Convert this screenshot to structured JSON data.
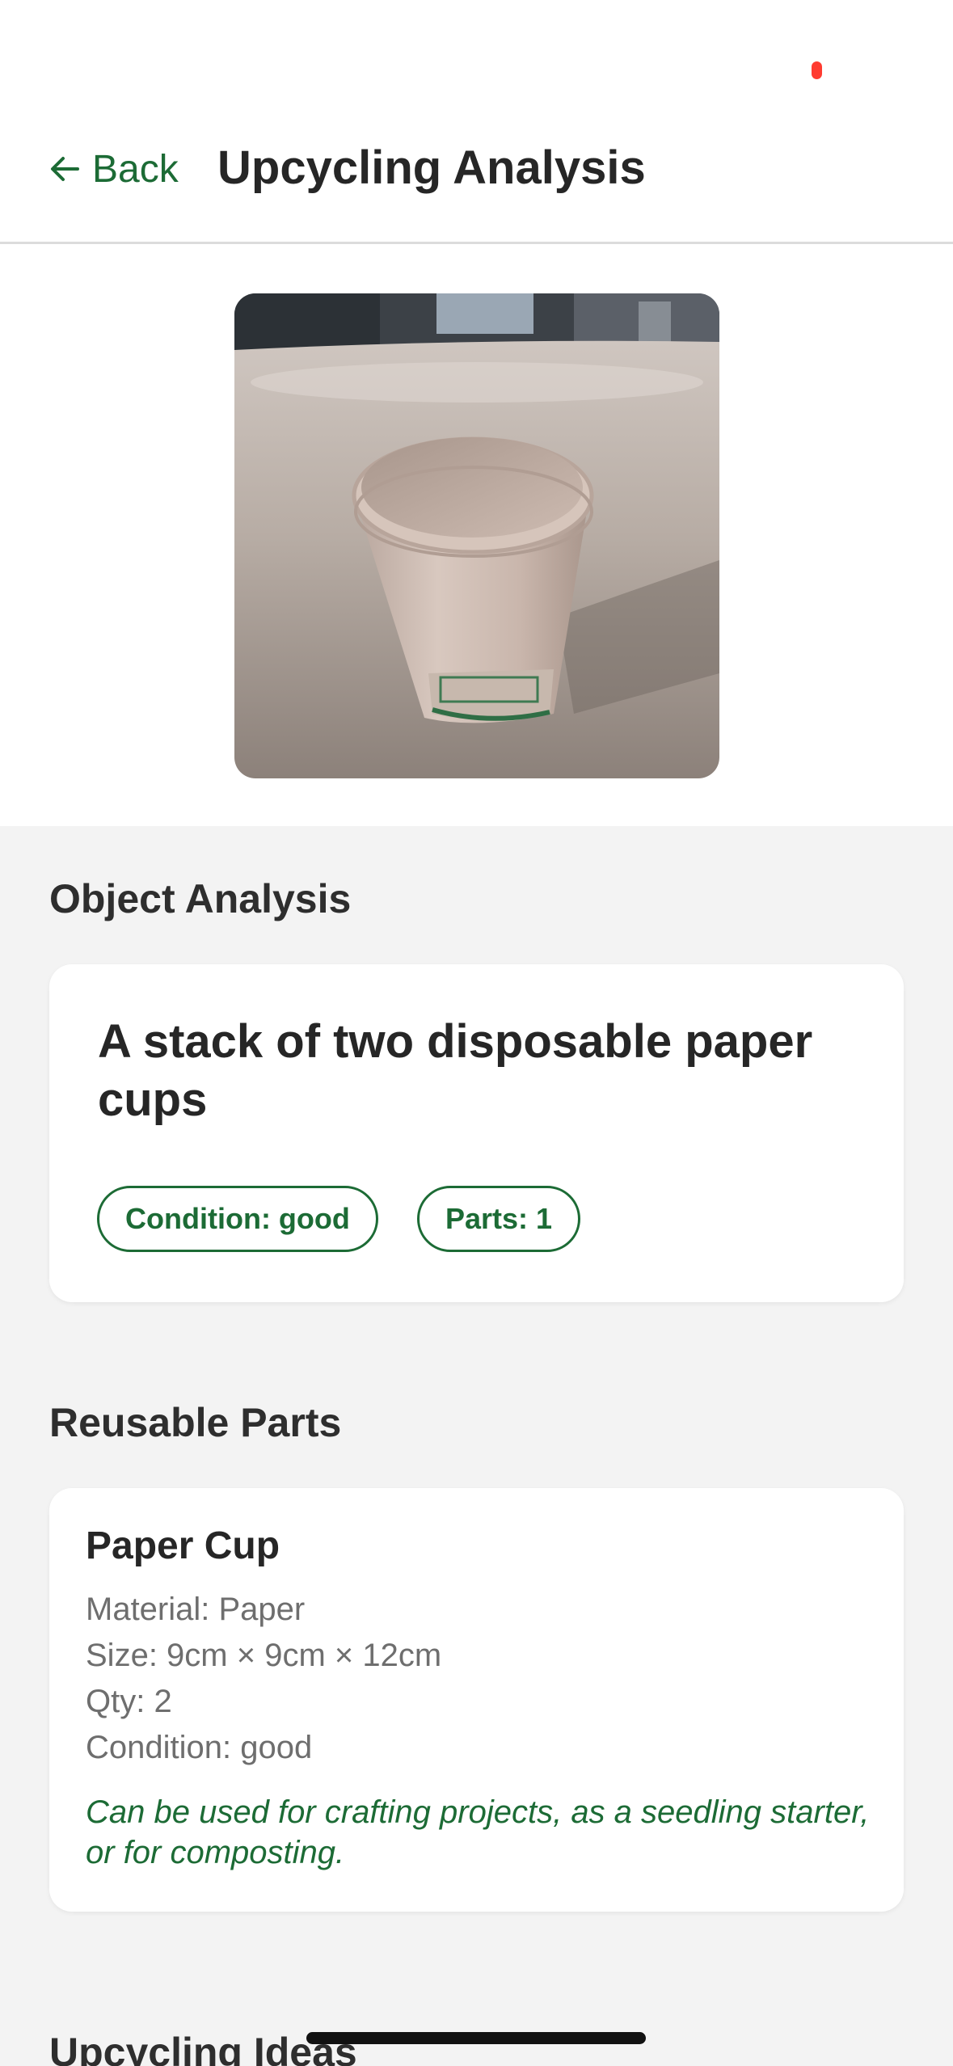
{
  "header": {
    "back_label": "Back",
    "title": "Upcycling Analysis"
  },
  "photo": {
    "alt": "A stack of two disposable paper cups"
  },
  "object_analysis": {
    "section_title": "Object Analysis",
    "name": "A stack of two disposable paper cups",
    "condition_chip": "Condition: good",
    "parts_chip": "Parts: 1"
  },
  "reusable_parts": {
    "section_title": "Reusable Parts",
    "items": [
      {
        "name": "Paper Cup",
        "material": "Material: Paper",
        "size": "Size: 9cm × 9cm × 12cm",
        "qty": "Qty: 2",
        "condition": "Condition: good",
        "note": "Can be used for crafting projects, as a seedling starter, or for composting."
      }
    ]
  },
  "upcycling_ideas": {
    "section_title": "Upcycling Ideas"
  },
  "colors": {
    "accent": "#1c6b35",
    "recording": "#ff3b30",
    "background": "#f3f3f3"
  },
  "icons": {
    "back": "arrow-left-icon"
  }
}
